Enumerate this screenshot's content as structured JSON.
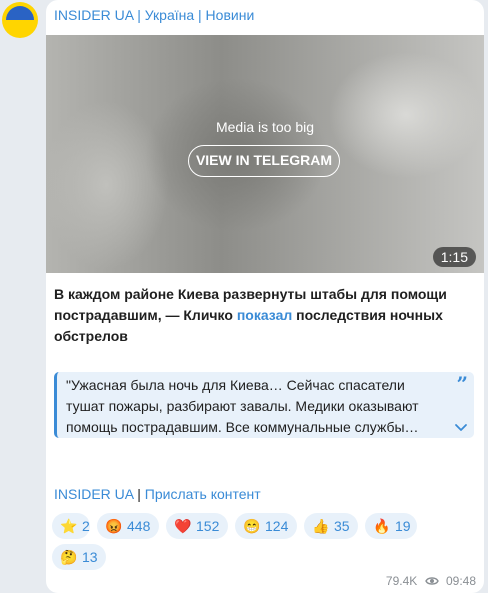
{
  "channel": {
    "name": "INSIDER UA | Україна | Новини"
  },
  "media": {
    "note": "Media is too big",
    "button_label": "VIEW IN TELEGRAM",
    "duration": "1:15"
  },
  "message": {
    "text_before_link": "В каждом районе Киева развернуты штабы для помощи пострадавшим, — Кличко ",
    "link_text": "показал",
    "text_after_link": " последствия ночных обстрелов"
  },
  "quote": {
    "text": "\"Ужасная была ночь для Киева… Сейчас спасатели тушат пожары, разбирают завалы. Медики оказывают помощь пострадавшим. Все коммунальные службы…"
  },
  "footer": {
    "link1": "INSIDER UA",
    "separator": " | ",
    "link2": "Прислать контент"
  },
  "reactions": [
    {
      "emoji": "⭐",
      "count": "2"
    },
    {
      "emoji": "😡",
      "count": "448"
    },
    {
      "emoji": "❤️",
      "count": "152"
    },
    {
      "emoji": "😁",
      "count": "124"
    },
    {
      "emoji": "👍",
      "count": "35"
    },
    {
      "emoji": "🔥",
      "count": "19"
    },
    {
      "emoji": "🤔",
      "count": "13"
    }
  ],
  "meta": {
    "views": "79.4K",
    "time": "09:48"
  },
  "colors": {
    "accent": "#3a8bd6",
    "bubble": "#ffffff",
    "background": "#e7ebf0"
  }
}
